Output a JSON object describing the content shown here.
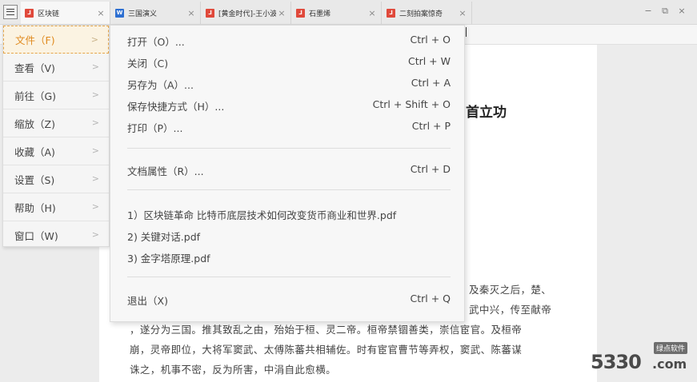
{
  "tabs": [
    {
      "label": "区块链",
      "icon": "pdf"
    },
    {
      "label": "三国演义",
      "icon": "word"
    },
    {
      "label": "[黄金时代]-王小波",
      "icon": "pdf"
    },
    {
      "label": "石墨烯",
      "icon": "pdf"
    },
    {
      "label": "二刻拍案惊奇",
      "icon": "pdf"
    }
  ],
  "tab_close": "×",
  "window_controls": {
    "minimize": "−",
    "restore": "⧉",
    "close": "×"
  },
  "side_menu": [
    {
      "label": "文件（F)"
    },
    {
      "label": "查看（V)"
    },
    {
      "label": "前往（G)"
    },
    {
      "label": "缩放（Z)"
    },
    {
      "label": "收藏（A)"
    },
    {
      "label": "设置（S)"
    },
    {
      "label": "帮助（H)"
    },
    {
      "label": "窗口（W)"
    }
  ],
  "chevron": ">",
  "file_menu": {
    "items": [
      {
        "label": "打开（O）...",
        "shortcut": "Ctrl + O"
      },
      {
        "label": "关闭（C)",
        "shortcut": "Ctrl + W"
      },
      {
        "label": "另存为（A）...",
        "shortcut": "Ctrl + A"
      },
      {
        "label": "保存快捷方式（H）...",
        "shortcut": "Ctrl + Shift + O"
      },
      {
        "label": "打印（P）...",
        "shortcut": "Ctrl + P"
      },
      {
        "label": "文档属性（R）...",
        "shortcut": "Ctrl + D"
      },
      {
        "label": "退出（X)",
        "shortcut": "Ctrl + Q"
      }
    ],
    "recent": [
      "1）区块链革命 比特币底层技术如何改变货币商业和世界.pdf",
      "2) 关键对话.pdf",
      "3) 金字塔原理.pdf"
    ]
  },
  "document": {
    "title_fragment": "首立功",
    "lines": [
      "及秦灭之后，楚、",
      "武中兴，传至献帝",
      "，遂分为三国。推其致乱之由，殆始于桓、灵二帝。桓帝禁锢善类，崇信宦官。及桓帝",
      "崩，灵帝即位，大将军窦武、太傅陈蕃共相辅佐。时有宦官曹节等弄权，窦武、陈蕃谋",
      "诛之，机事不密，反为所害，中涓自此愈横。"
    ]
  },
  "watermark": {
    "number": "5330",
    "suffix": ".com",
    "tag": "绿点软件"
  }
}
